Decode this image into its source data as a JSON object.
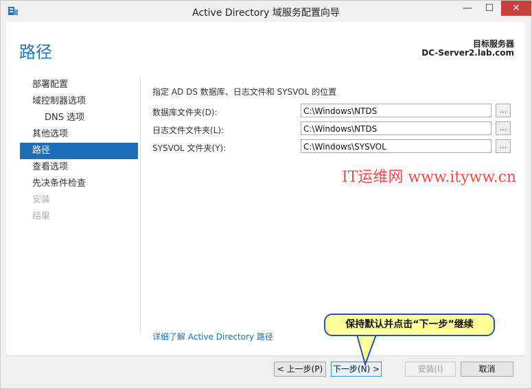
{
  "window": {
    "title": "Active Directory 域服务配置向导",
    "minimize_glyph": "—",
    "maximize_glyph": "☐",
    "close_glyph": "✕",
    "icon": "ad-wizard-icon"
  },
  "header": {
    "page_title": "路径",
    "target_label": "目标服务器",
    "target_server": "DC-Server2.lab.com"
  },
  "nav": {
    "items": [
      {
        "label": "部署配置",
        "state": "normal"
      },
      {
        "label": "域控制器选项",
        "state": "normal"
      },
      {
        "label": "DNS 选项",
        "state": "sub"
      },
      {
        "label": "其他选项",
        "state": "normal"
      },
      {
        "label": "路径",
        "state": "selected"
      },
      {
        "label": "查看选项",
        "state": "normal"
      },
      {
        "label": "先决条件检查",
        "state": "normal"
      },
      {
        "label": "安装",
        "state": "disabled"
      },
      {
        "label": "结果",
        "state": "disabled"
      }
    ]
  },
  "content": {
    "description": "指定 AD DS 数据库、日志文件和 SYSVOL 的位置",
    "rows": [
      {
        "label": "数据库文件夹(D):",
        "value": "C:\\Windows\\NTDS",
        "browse": "..."
      },
      {
        "label": "日志文件文件夹(L):",
        "value": "C:\\Windows\\NTDS",
        "browse": "..."
      },
      {
        "label": "SYSVOL 文件夹(Y):",
        "value": "C:\\Windows\\SYSVOL",
        "browse": "..."
      }
    ],
    "learn_more_link": "详细了解 Active Directory 路径"
  },
  "watermark": "IT运维网 www.ityww.cn",
  "callout": "保持默认并点击“下一步”继续",
  "footer": {
    "prev": "< 上一步(P)",
    "next": "下一步(N) >",
    "install": "安装(I)",
    "cancel": "取消"
  },
  "colors": {
    "accent": "#1f6fb8",
    "close_red": "#c7403a",
    "callout_fill": "#ffff9a",
    "callout_border": "#2a4fb3",
    "watermark": "#ef4a4a"
  }
}
